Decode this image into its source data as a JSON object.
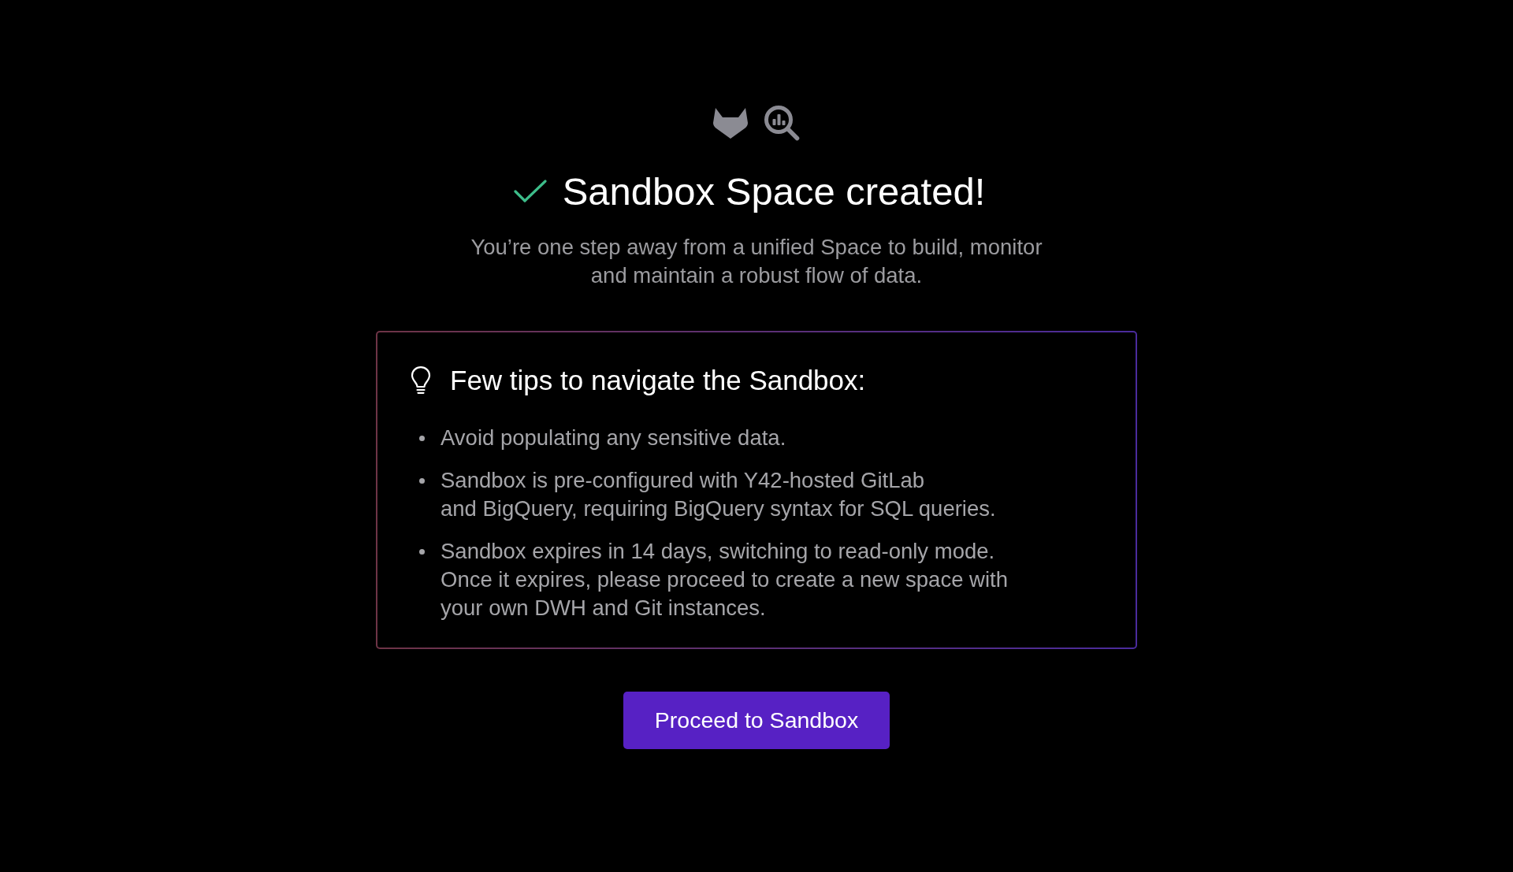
{
  "title": "Sandbox Space created!",
  "subtitle": "You’re one step away from a unified Space to build, monitor\nand maintain a robust flow of data.",
  "tips": {
    "heading": "Few tips to navigate the Sandbox:",
    "items": [
      "Avoid populating any sensitive data.",
      "Sandbox is pre-configured with Y42-hosted GitLab\nand BigQuery, requiring BigQuery syntax for SQL queries.",
      "Sandbox expires in 14 days, switching to read-only mode.\nOnce it expires, please proceed to create a new space with\nyour own DWH and Git instances."
    ]
  },
  "button": {
    "label": "Proceed to Sandbox"
  }
}
